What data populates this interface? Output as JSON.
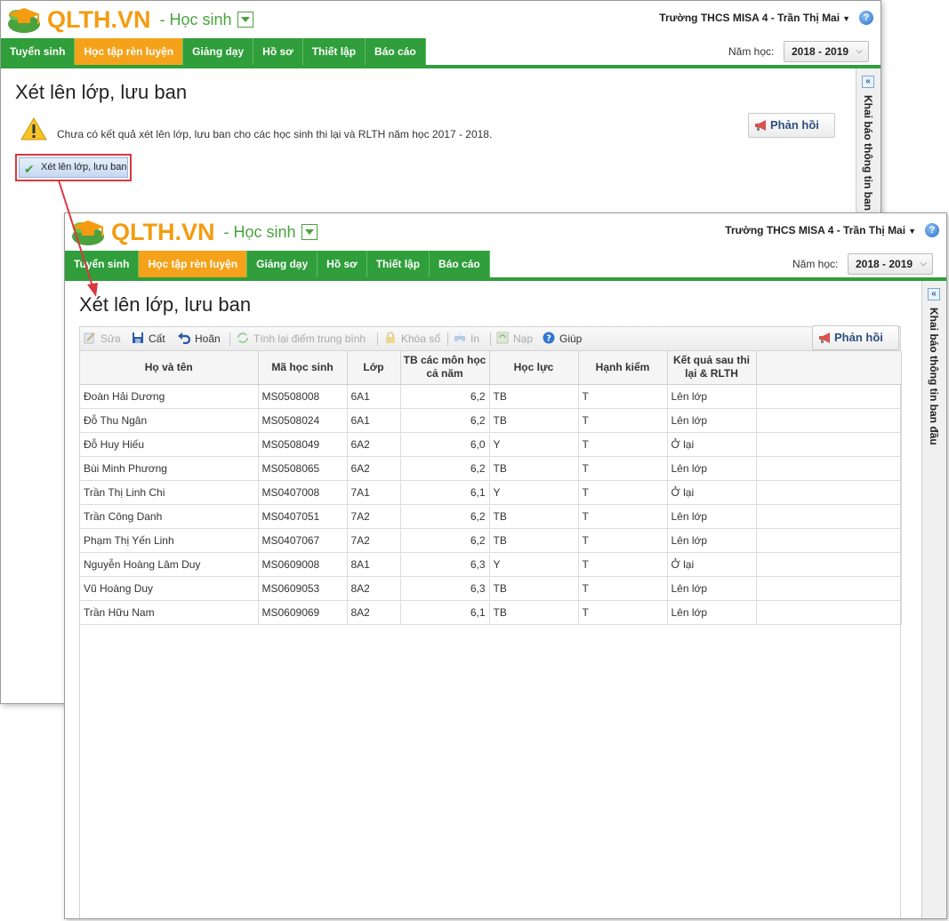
{
  "app": {
    "logo_text": "QLTH.VN",
    "module": "- Học sinh",
    "school_user": "Trường THCS MISA 4 - Trần Thị Mai",
    "help_glyph": "?",
    "year_label": "Năm học:",
    "year_value": "2018 - 2019",
    "tabs": [
      "Tuyển sinh",
      "Học tập rèn luyện",
      "Giảng dạy",
      "Hồ sơ",
      "Thiết lập",
      "Báo cáo"
    ],
    "active_tab": "Học tập rèn luyện",
    "side_panel_label": "Khai báo thông tin ban đầu",
    "feedback_label": "Phản hồi",
    "colors": {
      "brand_green": "#2f9e3b",
      "active_orange": "#f5a21b",
      "logo_orange": "#f39c12",
      "highlight_red": "#d9393e"
    }
  },
  "back_window": {
    "page_title": "Xét lên lớp, lưu ban",
    "warning_text": "Chưa có kết quả xét lên lớp, lưu ban cho các học sinh thi lại và RLTH năm học 2017 - 2018.",
    "action_button": "Xét lên lớp, lưu ban",
    "side_panel_label": "Khai báo thông tin ban đ"
  },
  "front_window": {
    "page_title": "Xét lên lớp, lưu ban",
    "toolbar": [
      {
        "label": "Sửa",
        "icon": "edit-icon",
        "enabled": false
      },
      {
        "label": "Cất",
        "icon": "save-icon",
        "enabled": true
      },
      {
        "label": "Hoãn",
        "icon": "undo-icon",
        "enabled": true
      },
      {
        "label": "Tính lại điểm trung bình",
        "icon": "recalculate-icon",
        "enabled": false
      },
      {
        "label": "Khóa sổ",
        "icon": "lock-icon",
        "enabled": false
      },
      {
        "label": "In",
        "icon": "print-icon",
        "enabled": false
      },
      {
        "label": "Nạp",
        "icon": "refresh-icon",
        "enabled": false
      },
      {
        "label": "Giúp",
        "icon": "help-icon",
        "enabled": true
      }
    ],
    "columns": [
      "Họ và tên",
      "Mã học sinh",
      "Lớp",
      "TB các môn học cả năm",
      "Học lực",
      "Hạnh kiểm",
      "Kết quả sau thi lại & RLTH"
    ],
    "rows": [
      [
        "Đoàn Hải Dương",
        "MS0508008",
        "6A1",
        "6,2",
        "TB",
        "T",
        "Lên lớp"
      ],
      [
        "Đỗ Thu Ngân",
        "MS0508024",
        "6A1",
        "6,2",
        "TB",
        "T",
        "Lên lớp"
      ],
      [
        "Đỗ Huy Hiếu",
        "MS0508049",
        "6A2",
        "6,0",
        "Y",
        "T",
        "Ở lại"
      ],
      [
        "Bùi Minh Phương",
        "MS0508065",
        "6A2",
        "6,2",
        "TB",
        "T",
        "Lên lớp"
      ],
      [
        "Trần Thị Linh Chi",
        "MS0407008",
        "7A1",
        "6,1",
        "Y",
        "T",
        "Ở lại"
      ],
      [
        "Trần Công Danh",
        "MS0407051",
        "7A2",
        "6,2",
        "TB",
        "T",
        "Lên lớp"
      ],
      [
        "Phạm Thị Yến Linh",
        "MS0407067",
        "7A2",
        "6,2",
        "TB",
        "T",
        "Lên lớp"
      ],
      [
        "Nguyễn Hoàng Lâm Duy",
        "MS0609008",
        "8A1",
        "6,3",
        "Y",
        "T",
        "Ở lại"
      ],
      [
        "Vũ Hoàng Duy",
        "MS0609053",
        "8A2",
        "6,3",
        "TB",
        "T",
        "Lên lớp"
      ],
      [
        "Trần Hữu Nam",
        "MS0609069",
        "8A2",
        "6,1",
        "TB",
        "T",
        "Lên lớp"
      ]
    ]
  }
}
